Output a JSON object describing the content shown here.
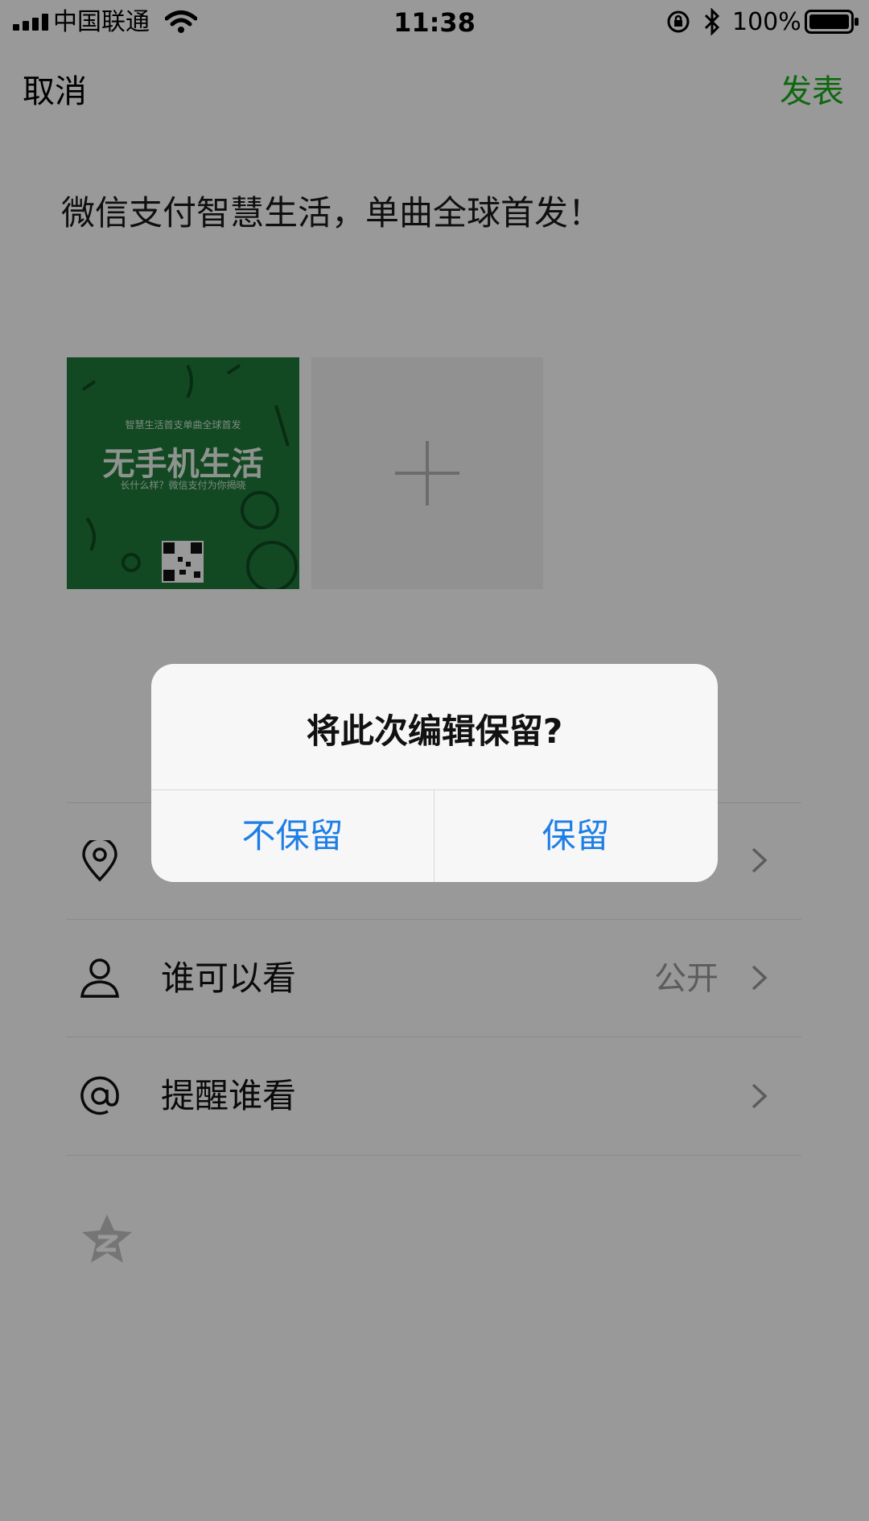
{
  "status_bar": {
    "carrier": "中国联通",
    "time": "11:38",
    "battery": "100%"
  },
  "nav": {
    "cancel_label": "取消",
    "publish_label": "发表",
    "publish_color": "#1aad19"
  },
  "post": {
    "text": "微信支付智慧生活，单曲全球首发！",
    "image": {
      "subtitle": "智慧生活首支单曲全球首发",
      "title": "无手机生活",
      "tagline": "长什么样？微信支付为你揭晓"
    }
  },
  "options": [
    {
      "label": "",
      "value": "",
      "icon": "location-pin-icon"
    },
    {
      "label": "谁可以看",
      "value": "公开",
      "icon": "person-icon"
    },
    {
      "label": "提醒谁看",
      "value": "",
      "icon": "at-icon"
    }
  ],
  "dialog": {
    "title": "将此次编辑保留?",
    "discard_label": "不保留",
    "keep_label": "保留",
    "button_color": "#1d7ee6"
  }
}
